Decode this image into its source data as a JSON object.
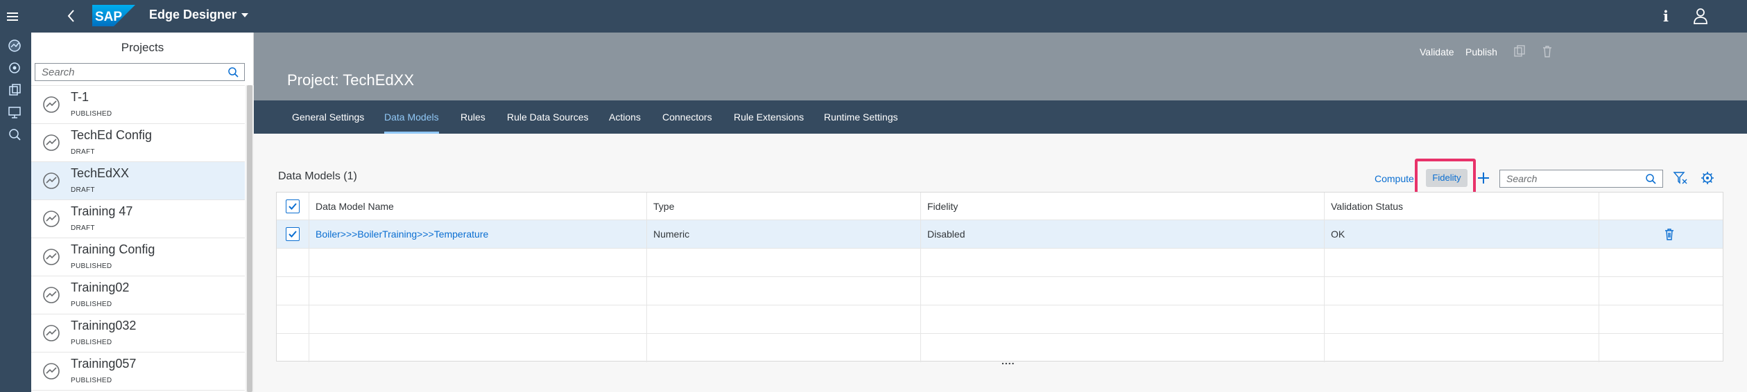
{
  "shell": {
    "app_title": "Edge Designer",
    "logo_text": "SAP",
    "info_glyph": "i"
  },
  "projects_panel": {
    "title": "Projects",
    "search_placeholder": "Search",
    "items": [
      {
        "name": "T-1",
        "status": "PUBLISHED"
      },
      {
        "name": "TechEd Config",
        "status": "DRAFT"
      },
      {
        "name": "TechEdXX",
        "status": "DRAFT",
        "selected": true
      },
      {
        "name": "Training 47",
        "status": "DRAFT"
      },
      {
        "name": "Training Config",
        "status": "PUBLISHED"
      },
      {
        "name": "Training02",
        "status": "PUBLISHED"
      },
      {
        "name": "Training032",
        "status": "PUBLISHED"
      },
      {
        "name": "Training057",
        "status": "PUBLISHED"
      }
    ]
  },
  "header": {
    "title": "Project: TechEdXX",
    "validate_label": "Validate",
    "publish_label": "Publish"
  },
  "tabs": [
    {
      "label": "General Settings"
    },
    {
      "label": "Data Models",
      "active": true
    },
    {
      "label": "Rules"
    },
    {
      "label": "Rule Data Sources"
    },
    {
      "label": "Actions"
    },
    {
      "label": "Connectors"
    },
    {
      "label": "Rule Extensions"
    },
    {
      "label": "Runtime Settings"
    }
  ],
  "data_models": {
    "title": "Data Models (1)",
    "compute_label": "Compute",
    "fidelity_label": "Fidelity",
    "search_placeholder": "Search",
    "columns": [
      "Data Model Name",
      "Type",
      "Fidelity",
      "Validation Status"
    ],
    "rows": [
      {
        "name": "Boiler>>>BoilerTraining>>>Temperature",
        "type": "Numeric",
        "fidelity": "Disabled",
        "validation_status": "OK"
      }
    ],
    "more_indicator": "...."
  },
  "colors": {
    "shell": "#354a5f",
    "header": "#8b959e",
    "accent": "#0a6ed1",
    "active_tab": "#91c8f6",
    "highlight": "#e8336a",
    "selected_row": "#e5f0fa"
  }
}
